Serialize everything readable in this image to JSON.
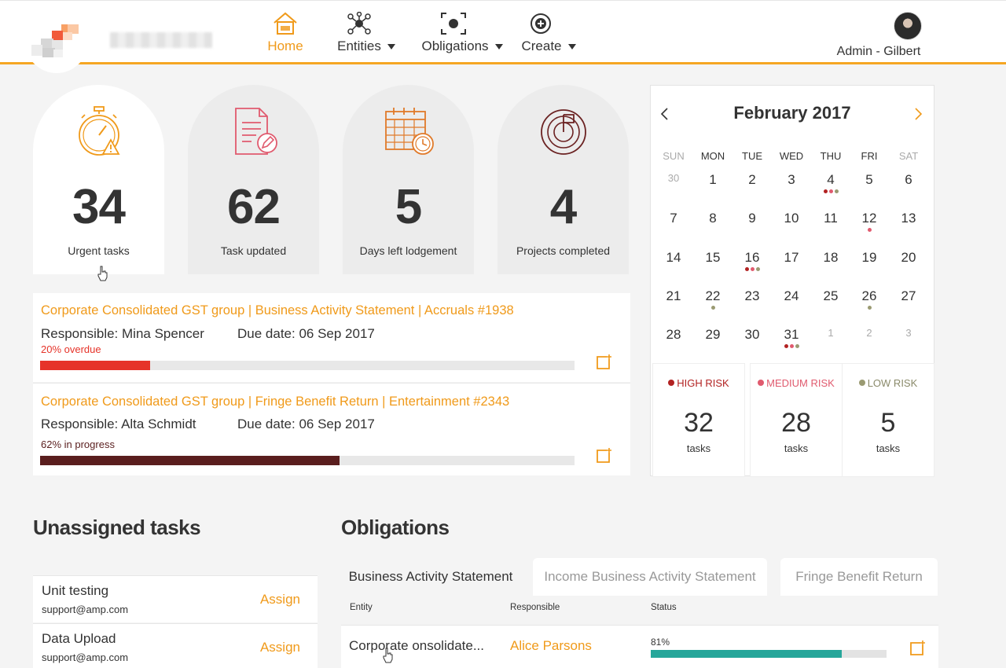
{
  "colors": {
    "accent": "#f09a1a",
    "high": "#b22222",
    "medium": "#e05a6e",
    "low": "#9a9a72",
    "teal": "#26a69a",
    "overdue": "#e63329",
    "progress": "#5a1e1e"
  },
  "nav": {
    "items": [
      {
        "label": "Home",
        "icon": "home-icon"
      },
      {
        "label": "Entities",
        "icon": "network-icon"
      },
      {
        "label": "Obligations",
        "icon": "focus-icon"
      },
      {
        "label": "Create",
        "icon": "plus-circle-icon"
      }
    ],
    "user": "Admin - Gilbert"
  },
  "stats": [
    {
      "value": "34",
      "caption": "Urgent tasks",
      "icon": "stopwatch-warning-icon"
    },
    {
      "value": "62",
      "caption": "Task updated",
      "icon": "document-edit-icon"
    },
    {
      "value": "5",
      "caption": "Days left lodgement",
      "icon": "calendar-clock-icon"
    },
    {
      "value": "4",
      "caption": "Projects completed",
      "icon": "target-flag-icon"
    }
  ],
  "tasks": [
    {
      "title": "Corporate Consolidated GST group |  Business Activity Statement  |  Accruals #1938",
      "responsible": "Responsible: Mina Spencer",
      "due": "Due date: 06 Sep 2017",
      "status": "20% overdue",
      "progress": 0.206
    },
    {
      "title": "Corporate Consolidated GST group |  Fringe Benefit Return | Entertainment #2343",
      "responsible": "Responsible: Alta Schmidt",
      "due": "Due date: 06 Sep 2017",
      "status": "62% in progress",
      "progress": 0.56
    }
  ],
  "calendar": {
    "month": "February 2017",
    "weekdays": [
      "SUN",
      "MON",
      "TUE",
      "WED",
      "THU",
      "FRI",
      "SAT"
    ],
    "days": [
      {
        "d": "30",
        "muted": true
      },
      {
        "d": "1"
      },
      {
        "d": "2"
      },
      {
        "d": "3"
      },
      {
        "d": "4",
        "dots": [
          "high",
          "medium",
          "low"
        ]
      },
      {
        "d": "5"
      },
      {
        "d": "6"
      },
      {
        "d": "7"
      },
      {
        "d": "8"
      },
      {
        "d": "9"
      },
      {
        "d": "10"
      },
      {
        "d": "11"
      },
      {
        "d": "12",
        "dots": [
          "medium"
        ]
      },
      {
        "d": "13"
      },
      {
        "d": "14"
      },
      {
        "d": "15"
      },
      {
        "d": "16",
        "dots": [
          "high",
          "medium",
          "low"
        ]
      },
      {
        "d": "17"
      },
      {
        "d": "18"
      },
      {
        "d": "19"
      },
      {
        "d": "20"
      },
      {
        "d": "21"
      },
      {
        "d": "22",
        "dots": [
          "low"
        ]
      },
      {
        "d": "23"
      },
      {
        "d": "24"
      },
      {
        "d": "25"
      },
      {
        "d": "26",
        "dots": [
          "low"
        ]
      },
      {
        "d": "27"
      },
      {
        "d": "28"
      },
      {
        "d": "29"
      },
      {
        "d": "30"
      },
      {
        "d": "31",
        "dots": [
          "high",
          "medium",
          "low"
        ]
      },
      {
        "d": "1",
        "muted": true
      },
      {
        "d": "2",
        "muted": true
      },
      {
        "d": "3",
        "muted": true
      }
    ],
    "risks": [
      {
        "label": "HIGH RISK",
        "count": "32",
        "unit": "tasks"
      },
      {
        "label": "MEDIUM RISK",
        "count": "28",
        "unit": "tasks"
      },
      {
        "label": "LOW RISK",
        "count": "5",
        "unit": "tasks"
      }
    ]
  },
  "unassigned": {
    "title": "Unassigned tasks",
    "action": "Assign",
    "items": [
      {
        "name": "Unit testing",
        "email": "support@amp.com"
      },
      {
        "name": "Data Upload",
        "email": "support@amp.com"
      }
    ]
  },
  "obligations": {
    "title": "Obligations",
    "tabs": [
      "Business Activity Statement",
      "Income Business Activity Statement",
      "Fringe Benefit Return"
    ],
    "columns": [
      "Entity",
      "Responsible",
      "Status"
    ],
    "rows": [
      {
        "entity": "Corporate onsolidate...",
        "responsible": "Alice Parsons",
        "status": "81%",
        "progress": 0.81
      }
    ]
  }
}
